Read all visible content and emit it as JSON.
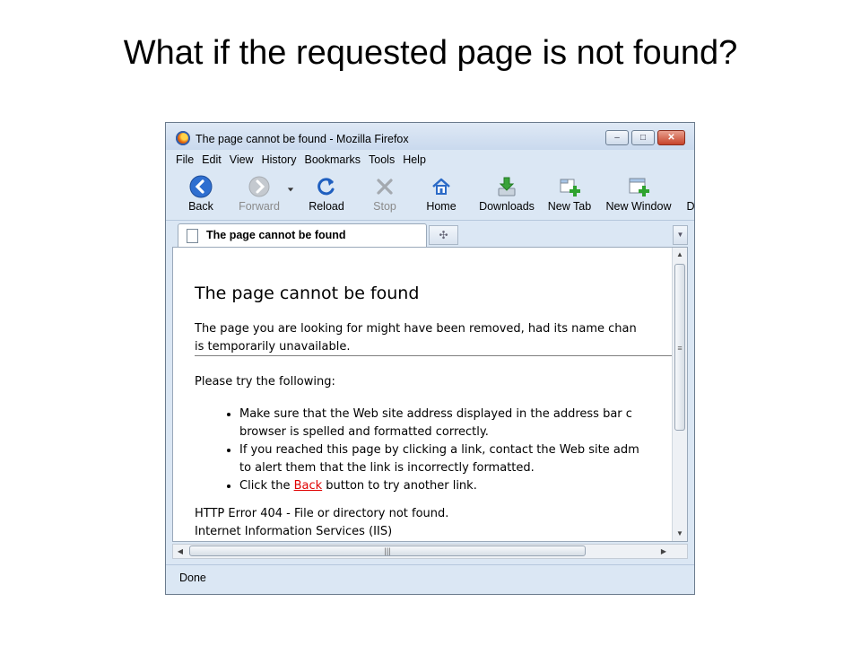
{
  "slide": {
    "title": "What if the requested page is not found?"
  },
  "window": {
    "title": "The page cannot be found - Mozilla Firefox",
    "controls": {
      "minimize": "–",
      "maximize": "□",
      "close": "✕"
    }
  },
  "menu": [
    "File",
    "Edit",
    "View",
    "History",
    "Bookmarks",
    "Tools",
    "Help"
  ],
  "toolbar": {
    "back": "Back",
    "forward": "Forward",
    "reload": "Reload",
    "stop": "Stop",
    "home": "Home",
    "downloads": "Downloads",
    "new_tab": "New Tab",
    "new_window": "New Window",
    "overflow": "D"
  },
  "tabs": {
    "active_title": "The page cannot be found",
    "new_tab_glyph": "✣",
    "list_glyph": "▼"
  },
  "page": {
    "heading": "The page cannot be found",
    "intro_line1": "The page you are looking for might have been removed, had its name chan",
    "intro_line2": "is temporarily unavailable.",
    "try_following": "Please try the following:",
    "bullet1_line1": "Make sure that the Web site address displayed in the address bar c",
    "bullet1_line2": "browser is spelled and formatted correctly.",
    "bullet2_line1": "If you reached this page by clicking a link, contact the Web site adm",
    "bullet2_line2": "to alert them that the link is incorrectly formatted.",
    "bullet3_pre": "Click the ",
    "bullet3_link": "Back",
    "bullet3_post": " button to try another link.",
    "error_line1": "HTTP Error 404 - File or directory not found.",
    "error_line2": "Internet Information Services (IIS)"
  },
  "status": {
    "text": "Done"
  },
  "icons": {
    "back": "back-arrow-icon",
    "forward": "forward-arrow-icon",
    "reload": "reload-icon",
    "stop": "stop-x-icon",
    "home": "home-icon",
    "downloads": "download-icon",
    "new_tab": "new-tab-icon",
    "new_window": "new-window-icon"
  },
  "colors": {
    "link": "#e00000",
    "accent": "#2b5fb3"
  }
}
